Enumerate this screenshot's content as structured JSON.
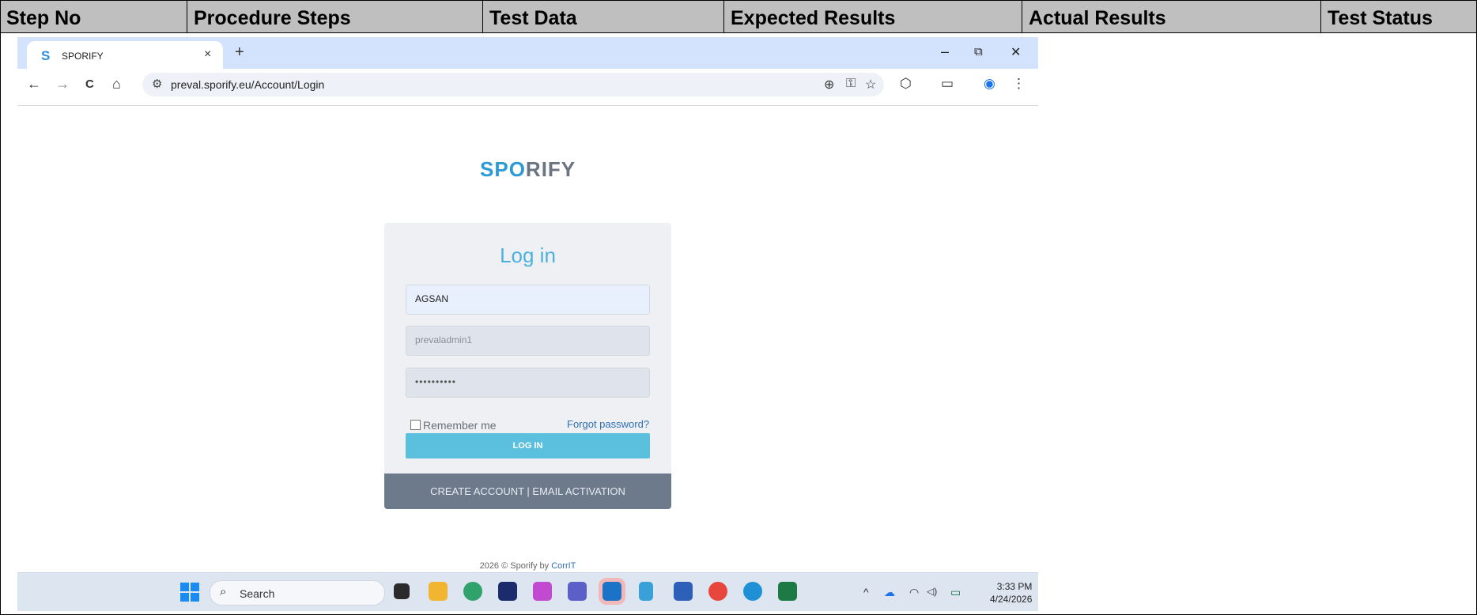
{
  "table_header": {
    "columns": [
      "Step No",
      "Procedure Steps",
      "Test Data",
      "Expected Results",
      "Actual Results",
      "Test Status"
    ]
  },
  "browser": {
    "tab_logo": "S",
    "tab_title": "SPORIFY",
    "tab_close": "×",
    "new_tab": "+",
    "minimize": "–",
    "restore": "⧉",
    "close": "✕",
    "back": "←",
    "forward": "→",
    "reload": "C",
    "home": "⌂",
    "site_info": "⚙",
    "url": "preval.sporify.eu/Account/Login",
    "zoom": "⊕",
    "key": "⚿",
    "star": "☆",
    "extensions": "⬡",
    "sidepanel": "▭",
    "profile": "◉",
    "menu": "⋮"
  },
  "page": {
    "brand_part1": "SP",
    "brand_part2": "O",
    "brand_part3": "RIFY",
    "login_title": "Log in",
    "tenant_value": "AGSAN",
    "username_value": "prevaladmin1",
    "password_value": "••••••••••",
    "remember_label": "Remember me",
    "forgot_label": "Forgot password?",
    "login_button": "LOG IN",
    "footer_links": "CREATE ACCOUNT | EMAIL ACTIVATION",
    "copyright_prefix": "2026 © Sporify by ",
    "copyright_link": "CorrIT"
  },
  "taskbar": {
    "search_label": "Search",
    "search_icon": "⌕",
    "tray_up": "^",
    "tray_cloud": "☁",
    "tray_wifi": "◠",
    "tray_volume": "◁)",
    "tray_battery": "▭",
    "time": "3:33 PM",
    "date": "4/24/2026"
  }
}
